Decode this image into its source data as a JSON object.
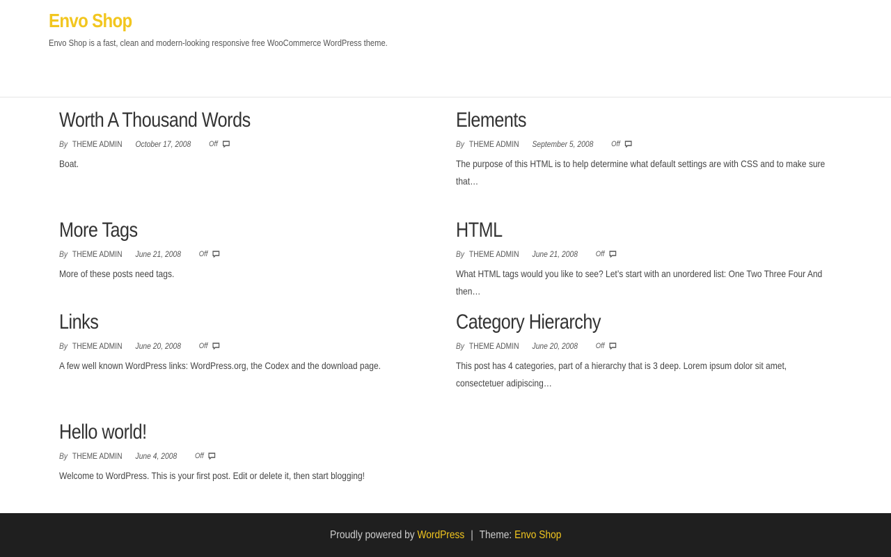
{
  "header": {
    "site_title": "Envo Shop",
    "site_description": "Envo Shop is a fast, clean and modern-looking responsive free WooCommerce WordPress theme."
  },
  "posts": [
    {
      "title": "Worth A Thousand Words",
      "by": "By",
      "author": "THEME ADMIN",
      "date": "October 17, 2008",
      "comments": "Off",
      "excerpt": "Boat."
    },
    {
      "title": "Elements",
      "by": "By",
      "author": "THEME ADMIN",
      "date": "September 5, 2008",
      "comments": "Off",
      "excerpt": "The purpose of this HTML is to help determine what default settings are with CSS and to make sure that…"
    },
    {
      "title": "More Tags",
      "by": "By",
      "author": "THEME ADMIN",
      "date": "June 21, 2008",
      "comments": "Off",
      "excerpt": "More of these posts need tags."
    },
    {
      "title": "HTML",
      "by": "By",
      "author": "THEME ADMIN",
      "date": "June 21, 2008",
      "comments": "Off",
      "excerpt": "What HTML tags would you like to see? Let’s start with an unordered list: One Two Three Four And then…"
    },
    {
      "title": "Links",
      "by": "By",
      "author": "THEME ADMIN",
      "date": "June 20, 2008",
      "comments": "Off",
      "excerpt": "A few well known WordPress links: WordPress.org, the Codex and the download page."
    },
    {
      "title": "Category Hierarchy",
      "by": "By",
      "author": "THEME ADMIN",
      "date": "June 20, 2008",
      "comments": "Off",
      "excerpt": "This post has 4 categories, part of a hierarchy that is 3 deep. Lorem ipsum dolor sit amet, consectetuer adipiscing…"
    },
    {
      "title": "Hello world!",
      "by": "By",
      "author": "THEME ADMIN",
      "date": "June 4, 2008",
      "comments": "Off",
      "excerpt": "Welcome to WordPress. This is your first post. Edit or delete it, then start blogging!"
    }
  ],
  "footer": {
    "powered_text": "Proudly powered by",
    "wordpress_link": "WordPress",
    "separator": "|",
    "theme_text": "Theme:",
    "theme_link": "Envo Shop"
  },
  "colors": {
    "accent": "#f2c61f",
    "footer_bg": "#1f1f1f",
    "text": "#333333"
  }
}
